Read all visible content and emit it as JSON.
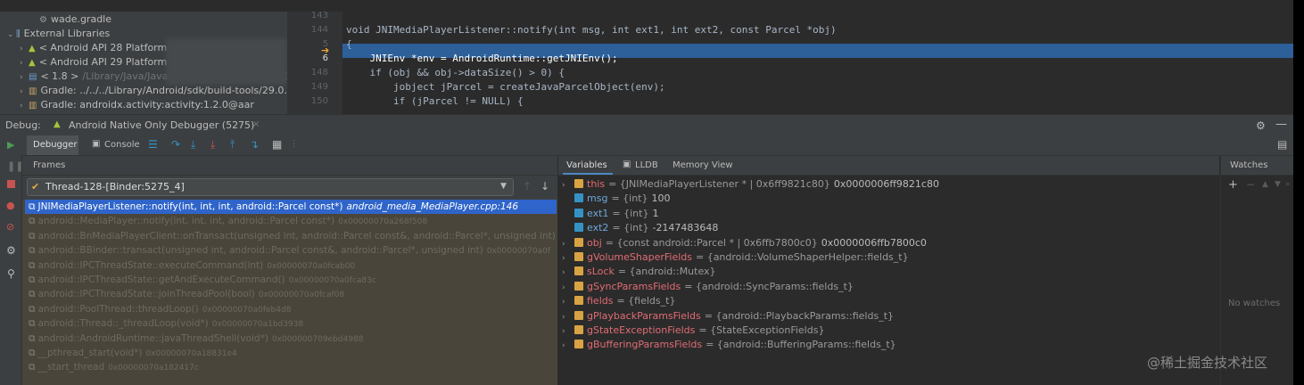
{
  "project": {
    "rows": [
      {
        "arrow": "",
        "icon": "⚙",
        "label": "wade.gradle"
      },
      {
        "arrow": "⌄",
        "icon": "⫼",
        "label": "External Libraries"
      },
      {
        "arrow": "›",
        "icon": "▲",
        "label": "< Android API 28 Platform"
      },
      {
        "arrow": "›",
        "icon": "▲",
        "label": "< Android API 29 Platform"
      },
      {
        "arrow": "›",
        "icon": "▤",
        "label": "< 1.8 >",
        "dim": "/Library/Java/JavaVirtualMachines/jdk1.8.0_"
      },
      {
        "arrow": "›",
        "icon": "▥",
        "label": "Gradle: ../../../Library/Android/sdk/build-tools/29.0.3"
      },
      {
        "arrow": "›",
        "icon": "▥",
        "label": "Gradle: androidx.activity:activity:1.2.0@aar"
      }
    ]
  },
  "editor": {
    "line_numbers": [
      "143",
      "144",
      "5",
      "6",
      "148",
      "149",
      "150"
    ],
    "lines": [
      "",
      "void JNIMediaPlayerListener::notify(int msg, int ext1, int ext2, const Parcel *obj)",
      "{",
      "    JNIEnv *env = AndroidRuntime::getJNIEnv();",
      "    if (obj && obj->dataSize() > 0) {",
      "        jobject jParcel = createJavaParcelObject(env);",
      "        if (jParcel != NULL) {"
    ]
  },
  "debug": {
    "label": "Debug:",
    "config": "Android Native Only Debugger (5275)",
    "tabs": [
      "Debugger",
      "Console"
    ]
  },
  "frames": {
    "header": "Frames",
    "thread": "Thread-128-[Binder:5275_4]",
    "items": [
      {
        "fn": "JNIMediaPlayerListener::notify(int, int, int, android::Parcel const*)",
        "loc": "android_media_MediaPlayer.cpp:146"
      },
      {
        "fn": "android::MediaPlayer::notify(int, int, int, android::Parcel const*)",
        "loc": "0x00000070a268f508"
      },
      {
        "fn": "android::BnMediaPlayerClient::onTransact(unsigned int, android::Parcel const&, android::Parcel*, unsigned int)",
        "loc": ""
      },
      {
        "fn": "android::BBinder::transact(unsigned int, android::Parcel const&, android::Parcel*, unsigned int)",
        "loc": "0x00000070a0f"
      },
      {
        "fn": "android::IPCThreadState::executeCommand(int)",
        "loc": "0x00000070a0fcab00"
      },
      {
        "fn": "android::IPCThreadState::getAndExecuteCommand()",
        "loc": "0x00000070a0fca83c"
      },
      {
        "fn": "android::IPCThreadState::joinThreadPool(bool)",
        "loc": "0x00000070a0fcaf08"
      },
      {
        "fn": "android::PoolThread::threadLoop()",
        "loc": "0x00000070a0feb4d8"
      },
      {
        "fn": "android::Thread::_threadLoop(void*)",
        "loc": "0x00000070a1bd3938"
      },
      {
        "fn": "android::AndroidRuntime::javaThreadShell(void*)",
        "loc": "0x000000709ebd4988"
      },
      {
        "fn": "__pthread_start(void*)",
        "loc": "0x00000070a18831e4"
      },
      {
        "fn": "__start_thread",
        "loc": "0x00000070a182417c"
      }
    ]
  },
  "variables": {
    "tabs": [
      "Variables",
      "LLDB",
      "Memory View"
    ],
    "items": [
      {
        "name": "this",
        "val": "= {JNIMediaPlayerListener * | 0x6ff9821c80}",
        "hex": "0x0000006ff9821c80",
        "kind": "ptr",
        "expand": true
      },
      {
        "name": "msg",
        "val": "= {int}",
        "hex": "100",
        "kind": "prim",
        "expand": false
      },
      {
        "name": "ext1",
        "val": "= {int}",
        "hex": "1",
        "kind": "prim",
        "expand": false
      },
      {
        "name": "ext2",
        "val": "= {int}",
        "hex": "-2147483648",
        "kind": "prim",
        "expand": false
      },
      {
        "name": "obj",
        "val": "= {const android::Parcel * | 0x6ffb7800c0}",
        "hex": "0x0000006ffb7800c0",
        "kind": "ptr",
        "expand": true
      },
      {
        "name": "gVolumeShaperFields",
        "val": "= {android::VolumeShaperHelper::fields_t}",
        "hex": "",
        "kind": "obj",
        "expand": true
      },
      {
        "name": "sLock",
        "val": "= {android::Mutex}",
        "hex": "",
        "kind": "obj",
        "expand": true
      },
      {
        "name": "gSyncParamsFields",
        "val": "= {android::SyncParams::fields_t}",
        "hex": "",
        "kind": "obj",
        "expand": true
      },
      {
        "name": "fields",
        "val": "= {fields_t}",
        "hex": "",
        "kind": "obj",
        "expand": true
      },
      {
        "name": "gPlaybackParamsFields",
        "val": "= {android::PlaybackParams::fields_t}",
        "hex": "",
        "kind": "obj",
        "expand": true
      },
      {
        "name": "gStateExceptionFields",
        "val": "= {StateExceptionFields}",
        "hex": "",
        "kind": "obj",
        "expand": true
      },
      {
        "name": "gBufferingParamsFields",
        "val": "= {android::BufferingParams::fields_t}",
        "hex": "",
        "kind": "obj",
        "expand": true
      }
    ]
  },
  "watches": {
    "header": "Watches",
    "empty": "No watches"
  },
  "watermark": "@稀土掘金技术社区"
}
